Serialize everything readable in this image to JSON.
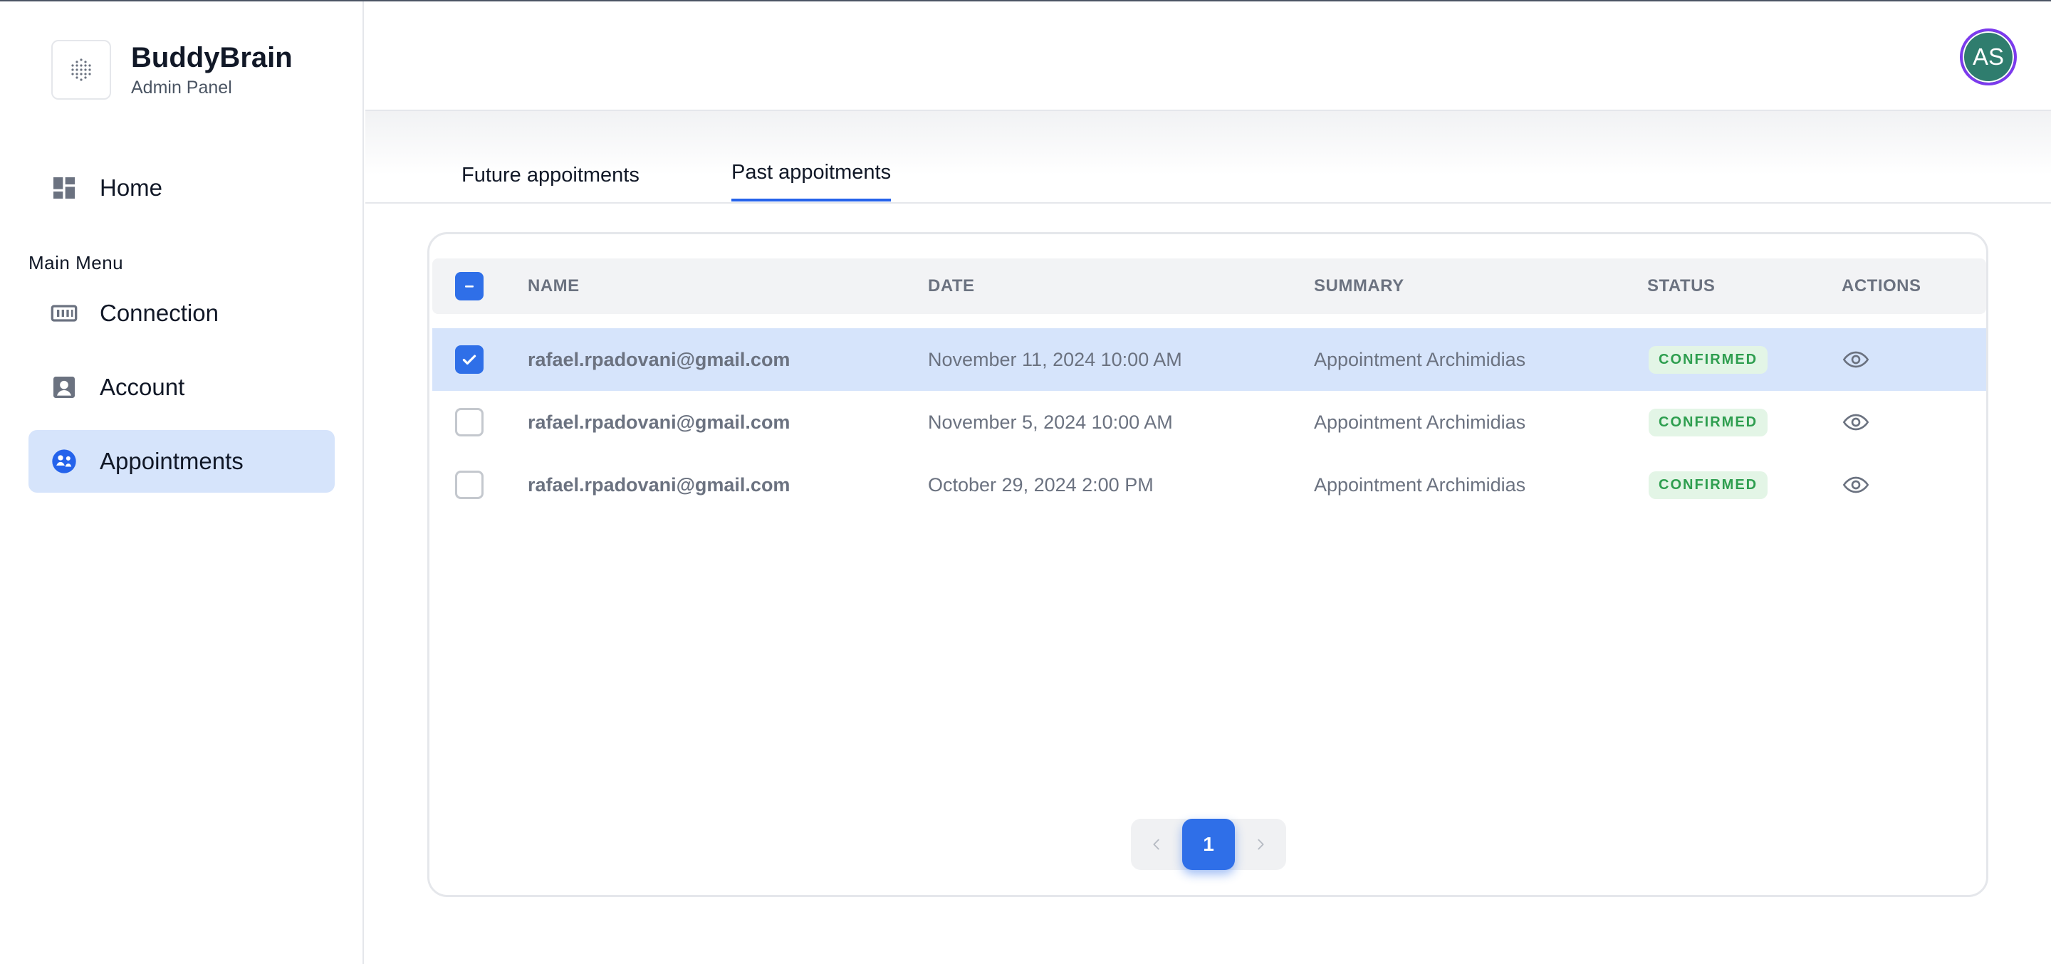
{
  "brand": {
    "title": "BuddyBrain",
    "subtitle": "Admin Panel"
  },
  "sidebar": {
    "home_label": "Home",
    "menu_label": "Main Menu",
    "items": [
      {
        "label": "Connection",
        "icon": "connection-icon"
      },
      {
        "label": "Account",
        "icon": "account-icon"
      },
      {
        "label": "Appointments",
        "icon": "appointments-icon",
        "active": true
      }
    ]
  },
  "header": {
    "avatar_initials": "AS"
  },
  "tabs": [
    {
      "label": "Future appoitments",
      "active": false
    },
    {
      "label": "Past appoitments",
      "active": true
    }
  ],
  "table": {
    "columns": [
      "NAME",
      "DATE",
      "SUMMARY",
      "STATUS",
      "ACTIONS"
    ],
    "rows": [
      {
        "name": "rafael.rpadovani@gmail.com",
        "date": "November 11, 2024 10:00 AM",
        "summary": "Appointment Archimidias",
        "status": "CONFIRMED",
        "selected": true
      },
      {
        "name": "rafael.rpadovani@gmail.com",
        "date": "November 5, 2024 10:00 AM",
        "summary": "Appointment Archimidias",
        "status": "CONFIRMED",
        "selected": false
      },
      {
        "name": "rafael.rpadovani@gmail.com",
        "date": "October 29, 2024 2:00 PM",
        "summary": "Appointment Archimidias",
        "status": "CONFIRMED",
        "selected": false
      }
    ]
  },
  "pagination": {
    "current_page": "1"
  },
  "colors": {
    "accent": "#2f6fe8",
    "active_bg": "#d6e4fb",
    "badge_text": "#2e9e4f",
    "badge_bg": "#e3f5e6",
    "avatar_bg": "#2f7d6e",
    "avatar_ring": "#7c3aed"
  }
}
